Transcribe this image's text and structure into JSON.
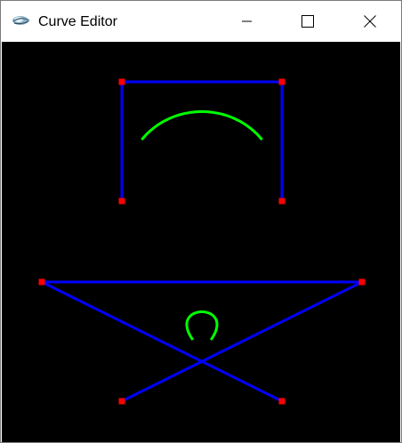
{
  "window": {
    "title": "Curve Editor"
  },
  "icons": {
    "app": "app-icon",
    "minimize": "minimize-icon",
    "maximize": "maximize-icon",
    "close": "close-icon"
  },
  "colors": {
    "canvas_background": "#000000",
    "control_polygon": "#0000ff",
    "control_point": "#ff0000",
    "curve": "#00ff00"
  }
}
